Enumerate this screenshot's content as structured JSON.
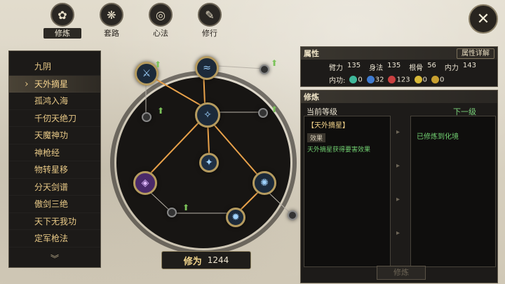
{
  "nav": {
    "tabs": [
      {
        "label": "修炼",
        "icon": "lotus-icon"
      },
      {
        "label": "套路",
        "icon": "dragon-icon"
      },
      {
        "label": "心法",
        "icon": "swirl-icon"
      },
      {
        "label": "修行",
        "icon": "scroll-icon"
      }
    ]
  },
  "skills": {
    "items": [
      "九阴",
      "天外摘星",
      "孤鸿入海",
      "千仞天绝刀",
      "天魔神功",
      "神枪经",
      "物转星移",
      "分天剑谱",
      "傲剑三绝",
      "天下无我功",
      "定军枪法"
    ]
  },
  "xiuwei": {
    "label": "修为",
    "value": "1244"
  },
  "attributes": {
    "title": "属性",
    "detail_button": "属性详解",
    "stats": [
      {
        "name": "臂力",
        "value": "135"
      },
      {
        "name": "身法",
        "value": "135"
      },
      {
        "name": "根骨",
        "value": "56"
      },
      {
        "name": "内力",
        "value": "143"
      }
    ],
    "neigong_label": "内功:",
    "neigong": [
      {
        "value": "0",
        "color": "#3fb89a"
      },
      {
        "value": "32",
        "color": "#3f7bd0"
      },
      {
        "value": "123",
        "color": "#c94040"
      },
      {
        "value": "0",
        "color": "#d6b838"
      },
      {
        "value": "0",
        "color": "#c8a030"
      }
    ]
  },
  "cultivation": {
    "title": "修炼",
    "current_label": "当前等级",
    "next_label": "下一级",
    "skill_name": "【天外摘星】",
    "effect_tag": "效果",
    "effect_text": "天外摘星获得要害效果",
    "next_text": "已修炼到化境",
    "button": "修炼"
  }
}
